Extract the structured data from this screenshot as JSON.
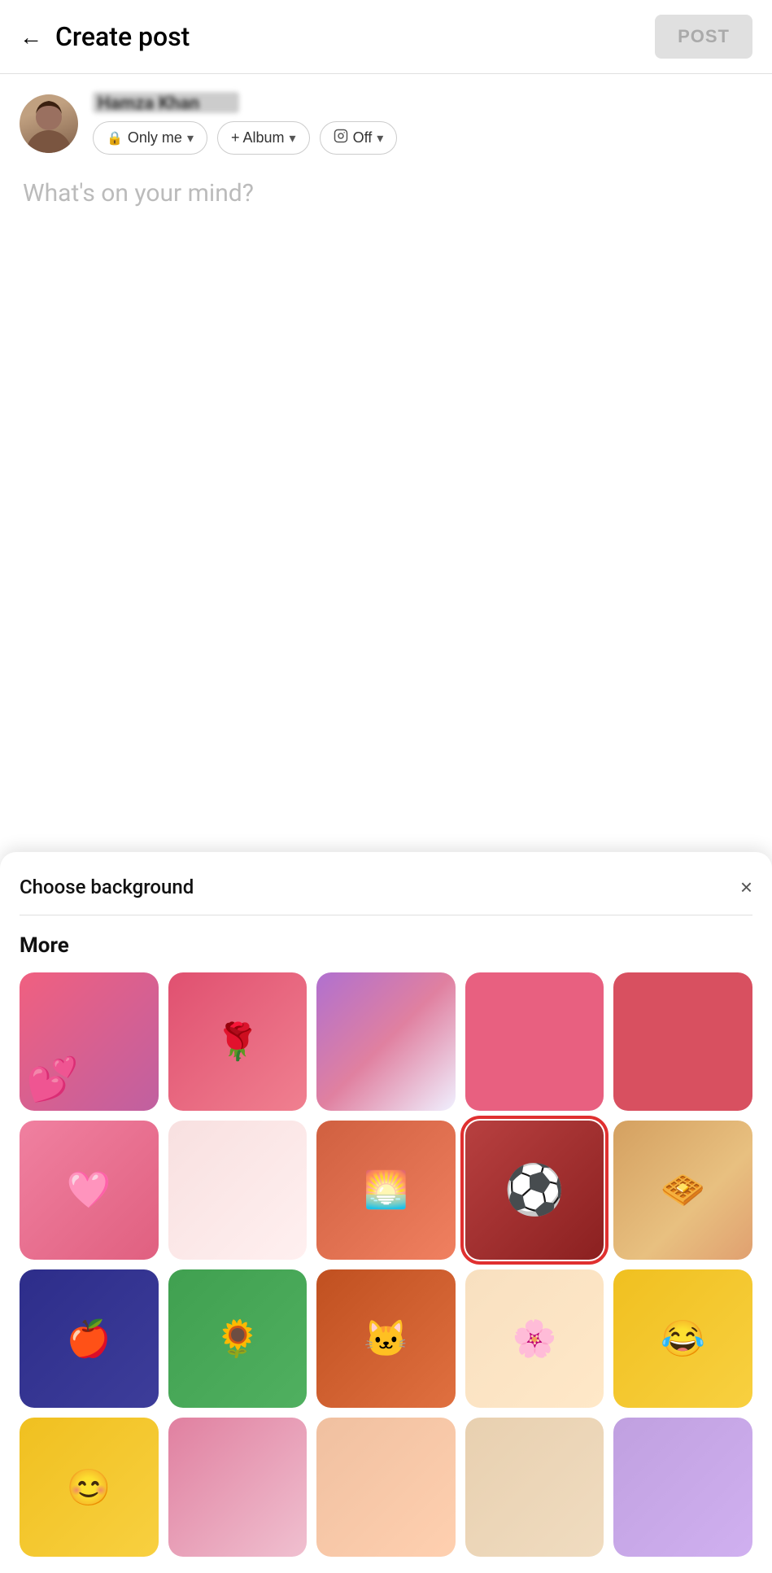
{
  "header": {
    "back_label": "←",
    "title": "Create post",
    "post_button_label": "POST"
  },
  "user": {
    "name": "Hamza Khan",
    "privacy_label": "Only me",
    "privacy_icon": "🔒",
    "album_label": "+ Album",
    "instagram_label": "Off",
    "instagram_icon": "instagram"
  },
  "post_placeholder": "What's on your mind?",
  "panel": {
    "title": "Choose background",
    "close_icon": "×",
    "section_label": "More"
  },
  "backgrounds": [
    {
      "id": "bg1",
      "label": "hearts",
      "class": "bg-hearts",
      "emoji": "💕",
      "selected": false
    },
    {
      "id": "bg2",
      "label": "rose",
      "class": "bg-rose",
      "emoji": "🌹",
      "selected": false
    },
    {
      "id": "bg3",
      "label": "stripes",
      "class": "bg-stripes",
      "emoji": "",
      "selected": false
    },
    {
      "id": "bg4",
      "label": "pink-plain",
      "class": "bg-pink-plain",
      "emoji": "",
      "selected": false
    },
    {
      "id": "bg5",
      "label": "coral-plain",
      "class": "bg-coral-plain",
      "emoji": "",
      "selected": false
    },
    {
      "id": "bg6",
      "label": "pink-heart2",
      "class": "bg-pink-heart2",
      "emoji": "🩷",
      "selected": false
    },
    {
      "id": "bg7",
      "label": "light-pink",
      "class": "bg-light-pink",
      "emoji": "",
      "selected": false
    },
    {
      "id": "bg8",
      "label": "sunset",
      "class": "bg-sunset",
      "emoji": "🌅",
      "selected": false
    },
    {
      "id": "bg9",
      "label": "soccer",
      "class": "bg-soccer",
      "emoji": "⚽",
      "selected": true
    },
    {
      "id": "bg10",
      "label": "tan-waffle",
      "class": "bg-tan-waffle",
      "emoji": "🧇",
      "selected": false
    },
    {
      "id": "bg11",
      "label": "apple",
      "class": "bg-apple",
      "emoji": "🍎",
      "selected": false
    },
    {
      "id": "bg12",
      "label": "yellow-flower",
      "class": "bg-yellow-flower",
      "emoji": "🌻",
      "selected": false
    },
    {
      "id": "bg13",
      "label": "cat",
      "class": "bg-cat",
      "emoji": "🐱",
      "selected": false
    },
    {
      "id": "bg14",
      "label": "floral",
      "class": "bg-floral",
      "emoji": "🌸",
      "selected": false
    },
    {
      "id": "bg15",
      "label": "laughing",
      "class": "bg-laughing",
      "emoji": "😂",
      "selected": false
    },
    {
      "id": "bg16",
      "label": "smile",
      "class": "bg-smile",
      "emoji": "😊",
      "selected": false
    },
    {
      "id": "bg17",
      "label": "pink-grad",
      "class": "bg-pink-grad",
      "emoji": "",
      "selected": false
    },
    {
      "id": "bg18",
      "label": "peach",
      "class": "bg-peach",
      "emoji": "",
      "selected": false
    },
    {
      "id": "bg19",
      "label": "wheat",
      "class": "bg-wheat",
      "emoji": "",
      "selected": false
    },
    {
      "id": "bg20",
      "label": "purple-swirl",
      "class": "bg-purple-swirl",
      "emoji": "",
      "selected": false
    }
  ]
}
